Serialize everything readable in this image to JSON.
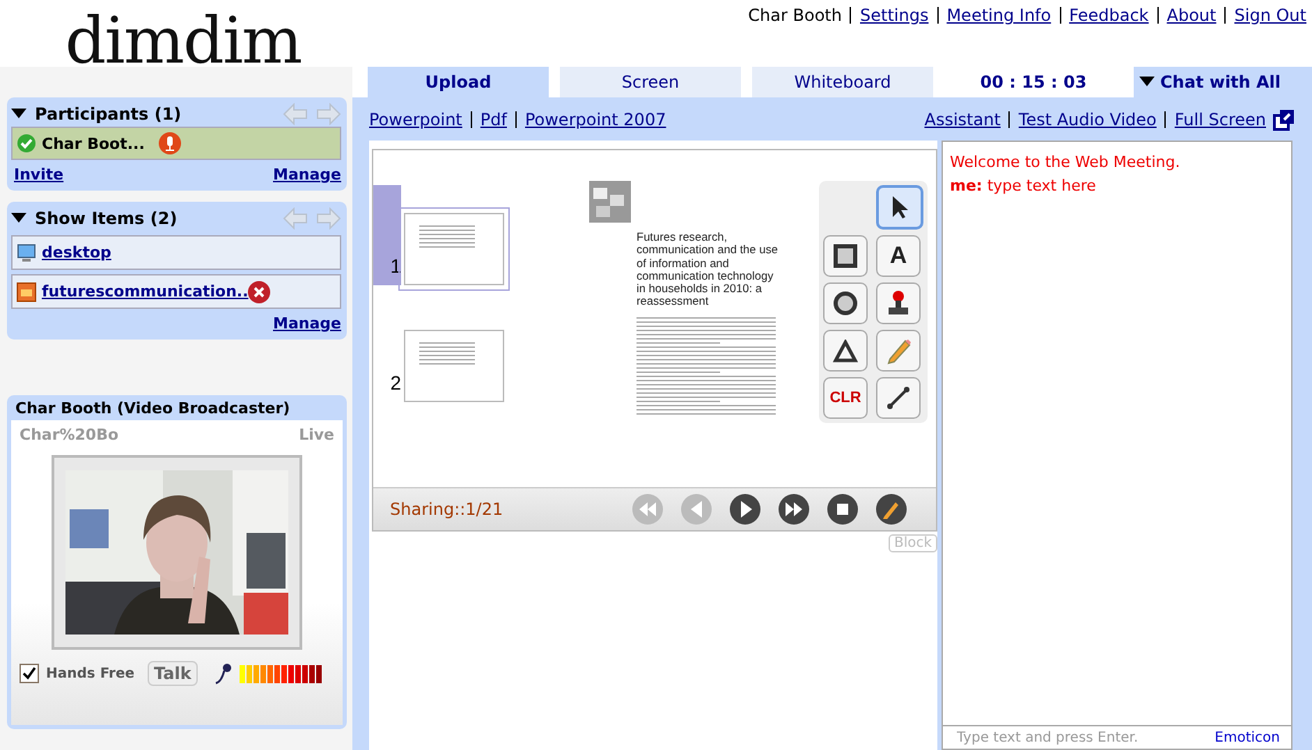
{
  "logo": {
    "text": "dimdim"
  },
  "header": {
    "user": "Char Booth",
    "links": [
      "Settings",
      "Meeting Info",
      "Feedback",
      "About",
      "Sign Out"
    ]
  },
  "participants": {
    "title": "Participants (1)",
    "expanded": true,
    "items": [
      {
        "name": "Char Boot...",
        "selected": true
      }
    ],
    "invite": "Invite",
    "manage": "Manage"
  },
  "show_items": {
    "title": "Show Items (2)",
    "expanded": true,
    "items": [
      {
        "name": "desktop",
        "kind": "desktop"
      },
      {
        "name": "futurescommunication..",
        "kind": "presentation"
      }
    ],
    "manage": "Manage"
  },
  "video": {
    "title": "Char Booth (Video Broadcaster)",
    "name": "Char%20Bo",
    "status": "Live",
    "hands_free": {
      "label": "Hands Free",
      "checked": true
    },
    "talk": "Talk"
  },
  "tabs": [
    {
      "label": "Upload",
      "selected": true
    },
    {
      "label": "Screen",
      "selected": false
    },
    {
      "label": "Whiteboard",
      "selected": false
    }
  ],
  "timer": "00 : 15 : 03",
  "upload_links": [
    "Powerpoint",
    "Pdf",
    "Powerpoint 2007"
  ],
  "tool_links": [
    "Assistant",
    "Test Audio Video",
    "Full Screen"
  ],
  "presentation": {
    "thumbnails": [
      {
        "number": "1",
        "selected": true
      },
      {
        "number": "2",
        "selected": false
      }
    ],
    "slide_title": "Futures research, communication and the use of information and communication technology in households in 2010: a reassessment",
    "tools": [
      {
        "kind": "select",
        "selected": true
      },
      {
        "kind": "rectangle",
        "selected": false
      },
      {
        "kind": "text",
        "label": "A",
        "selected": false
      },
      {
        "kind": "circle",
        "selected": false
      },
      {
        "kind": "stamp",
        "selected": false
      },
      {
        "kind": "triangle",
        "selected": false
      },
      {
        "kind": "pencil",
        "selected": false
      },
      {
        "kind": "clear",
        "label": "CLR",
        "selected": false
      },
      {
        "kind": "line",
        "selected": false
      }
    ],
    "sharing": "Sharing::1/21",
    "controls": [
      {
        "kind": "first",
        "disabled": true
      },
      {
        "kind": "previous",
        "disabled": true
      },
      {
        "kind": "play",
        "disabled": false
      },
      {
        "kind": "next",
        "disabled": false
      },
      {
        "kind": "stop",
        "disabled": false
      },
      {
        "kind": "annotate",
        "disabled": false
      }
    ],
    "block": "Block"
  },
  "chat": {
    "title": "Chat with All",
    "messages": [
      {
        "kind": "system",
        "text": "Welcome to the Web Meeting."
      },
      {
        "kind": "user",
        "sender": "me:",
        "text": "type text here"
      }
    ],
    "placeholder": "Type text and press Enter.",
    "emoticon": "Emoticon"
  }
}
